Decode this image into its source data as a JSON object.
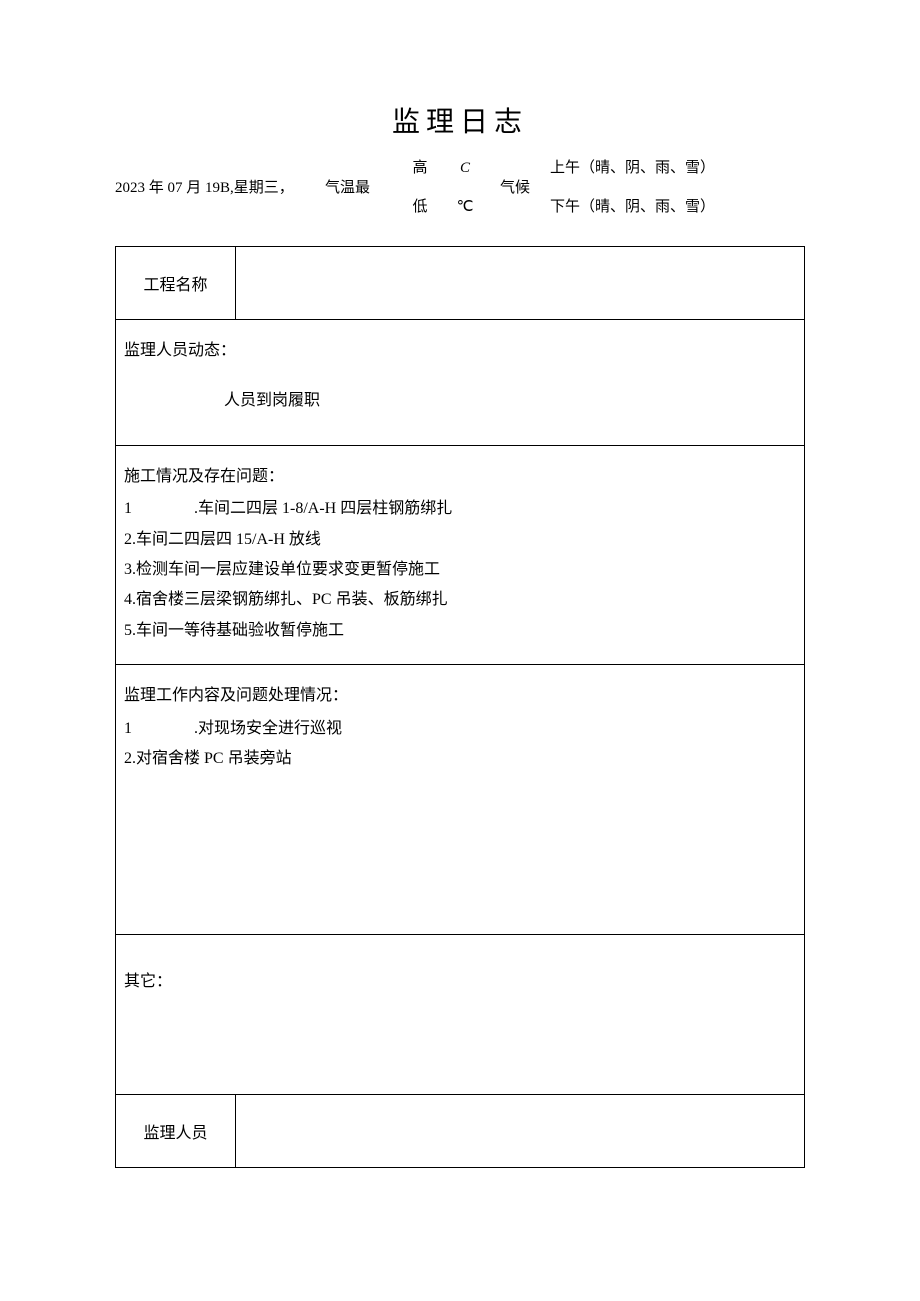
{
  "title": "监理日志",
  "meta": {
    "date": "2023 年 07 月 19B,星期三，",
    "temp_label": "气温最",
    "high_label": "高",
    "high_unit": "C",
    "low_label": "低",
    "low_unit": "℃",
    "climate_label": "气候",
    "am": "上午（晴、阴、雨、雪）",
    "pm": "下午（晴、阴、雨、雪）"
  },
  "rows": {
    "project_name_label": "工程名称",
    "project_name_value": "",
    "personnel_heading": "监理人员动态：",
    "personnel_body": "人员到岗履职",
    "construction_heading": "施工情况及存在问题：",
    "construction_items": [
      {
        "n": "1",
        "t": ".车间二四层 1-8/A-H 四层柱钢筋绑扎"
      },
      {
        "n": "",
        "t": "2.车间二四层四 15/A-H 放线"
      },
      {
        "n": "",
        "t": "3.检测车间一层应建设单位要求变更暂停施工"
      },
      {
        "n": "",
        "t": "4.宿舍楼三层梁钢筋绑扎、PC 吊装、板筋绑扎"
      },
      {
        "n": "",
        "t": "5.车间一等待基础验收暂停施工"
      }
    ],
    "supervision_heading": "监理工作内容及问题处理情况：",
    "supervision_items": [
      {
        "n": "1",
        "t": ".对现场安全进行巡视"
      },
      {
        "n": "",
        "t": "2.对宿舍楼 PC 吊装旁站"
      }
    ],
    "others_heading": "其它：",
    "footer_label": "监理人员",
    "footer_value": ""
  }
}
